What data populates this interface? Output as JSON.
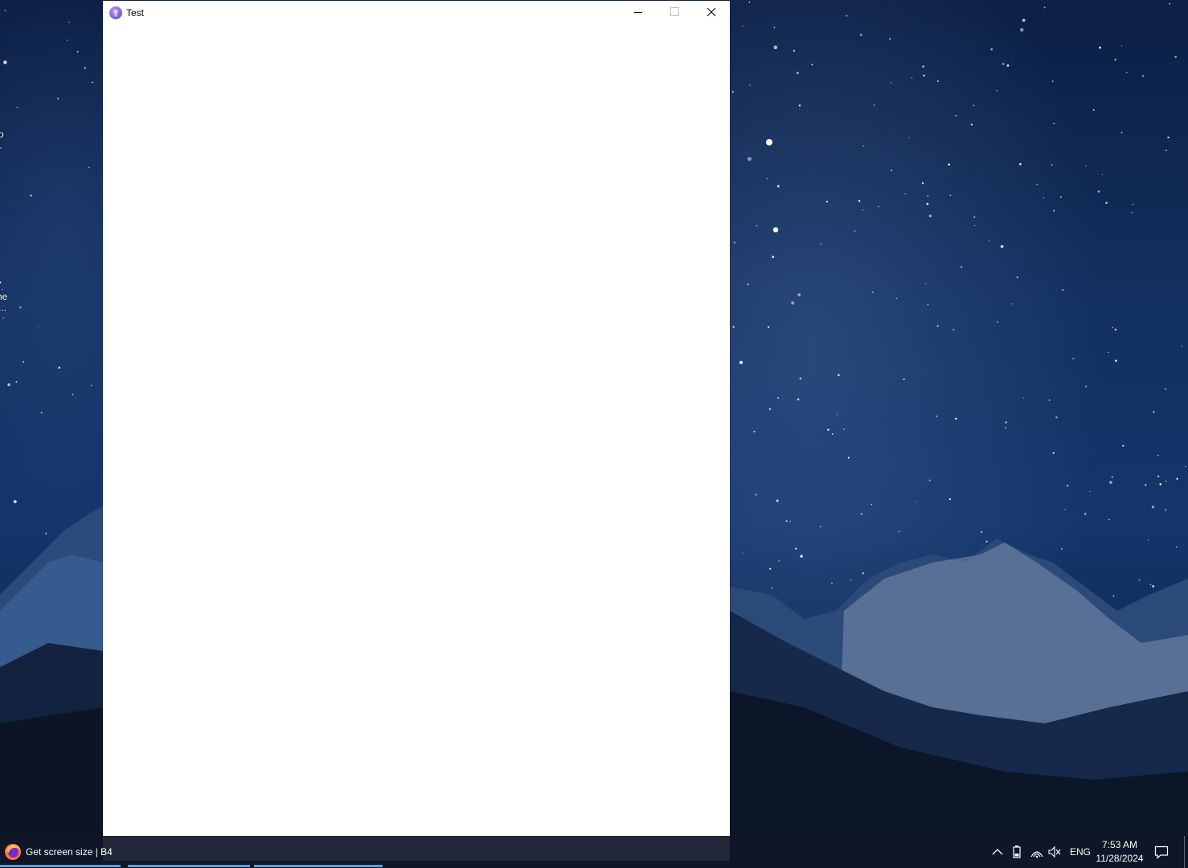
{
  "desktop": {
    "edge_labels": [
      "o",
      "-",
      "ne",
      "..."
    ]
  },
  "window": {
    "title": "Test",
    "icon": "app-icon",
    "controls": {
      "minimize_icon": "minimize-icon",
      "maximize_icon": "maximize-icon",
      "close_icon": "close-icon"
    }
  },
  "taskbar": {
    "app": {
      "label": "Get screen size | B4",
      "icon": "firefox-icon"
    },
    "tray": {
      "chevron_icon": "chevron-up-icon",
      "battery_icon": "battery-icon",
      "network_icon": "wifi-icon",
      "volume_icon": "volume-muted-icon",
      "language": "ENG",
      "time": "7:53 AM",
      "date": "11/28/2024",
      "notification_icon": "notification-icon"
    }
  },
  "colors": {
    "accent_underline": "#5b9bd5",
    "taskbar_bg": "#0f1626",
    "window_bg": "#ffffff"
  }
}
